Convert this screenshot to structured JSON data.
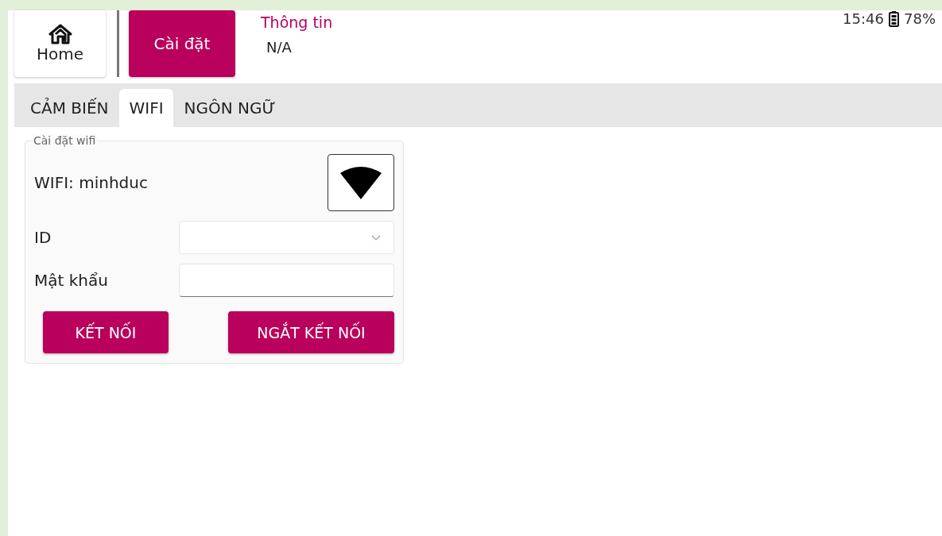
{
  "nav": [
    {
      "label": "Home",
      "kind": "home",
      "selected": false
    },
    {
      "label": "Cài đặt",
      "kind": "plain",
      "selected": true
    }
  ],
  "info": {
    "title": "Thông tin",
    "value": "N/A"
  },
  "status": {
    "time": "15:46",
    "battery": "78%"
  },
  "tabs": [
    {
      "label": "CẢM BIẾN",
      "selected": false
    },
    {
      "label": "WIFI",
      "selected": true
    },
    {
      "label": "NGÔN NGỮ",
      "selected": false
    }
  ],
  "wifi_group": {
    "legend": "Cài đặt wifi",
    "current": "WIFI: minhduc",
    "fields": [
      {
        "label": "ID",
        "kind": "dropdown"
      },
      {
        "label": "Mật khẩu",
        "kind": "text"
      }
    ],
    "buttons": [
      "KẾT NỐI",
      "NGẮT KẾT NỐI"
    ]
  }
}
